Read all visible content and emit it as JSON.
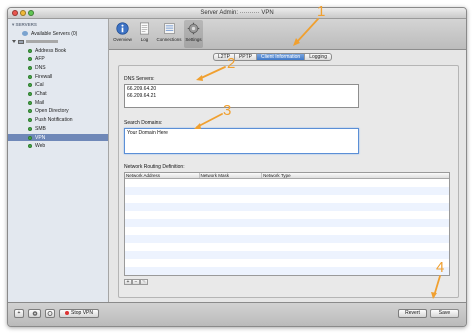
{
  "window": {
    "title": "Server Admin: ·········· VPN"
  },
  "sidebar": {
    "header": "▾ SERVERS",
    "available_servers": "Available Servers (0)",
    "items": [
      {
        "label": "Address Book"
      },
      {
        "label": "AFP"
      },
      {
        "label": "DNS"
      },
      {
        "label": "Firewall"
      },
      {
        "label": "iCal"
      },
      {
        "label": "iChat"
      },
      {
        "label": "Mail"
      },
      {
        "label": "Open Directory"
      },
      {
        "label": "Push Notification"
      },
      {
        "label": "SMB"
      },
      {
        "label": "VPN",
        "selected": true
      },
      {
        "label": "Web"
      }
    ]
  },
  "toolbar": {
    "buttons": [
      {
        "label": "Overview",
        "icon": "info-icon"
      },
      {
        "label": "Log",
        "icon": "log-icon"
      },
      {
        "label": "Connections",
        "icon": "connections-icon"
      },
      {
        "label": "Settings",
        "icon": "settings-icon",
        "active": true
      }
    ]
  },
  "tabs": [
    "L2TP",
    "PPTP",
    "Client Information",
    "Logging"
  ],
  "active_tab": "Client Information",
  "form": {
    "dns_label": "DNS Servers:",
    "dns_lines": [
      "66.209.64.20",
      "66.209.64.21"
    ],
    "search_label": "Search Domains:",
    "search_value": "Your Domain Here",
    "routing_label": "Network Routing Definition:",
    "columns": [
      "Network Address",
      "Network Mask",
      "Network Type"
    ]
  },
  "table_buttons": [
    "+",
    "−",
    "✎"
  ],
  "bottom": {
    "stop_label": "Stop VPN",
    "revert_label": "Revert",
    "save_label": "Save"
  },
  "annotations": [
    "1",
    "2",
    "3",
    "4"
  ],
  "colors": {
    "annotation": "#f0a030",
    "selection": "#6f88b8",
    "accent": "#3f78c8"
  }
}
